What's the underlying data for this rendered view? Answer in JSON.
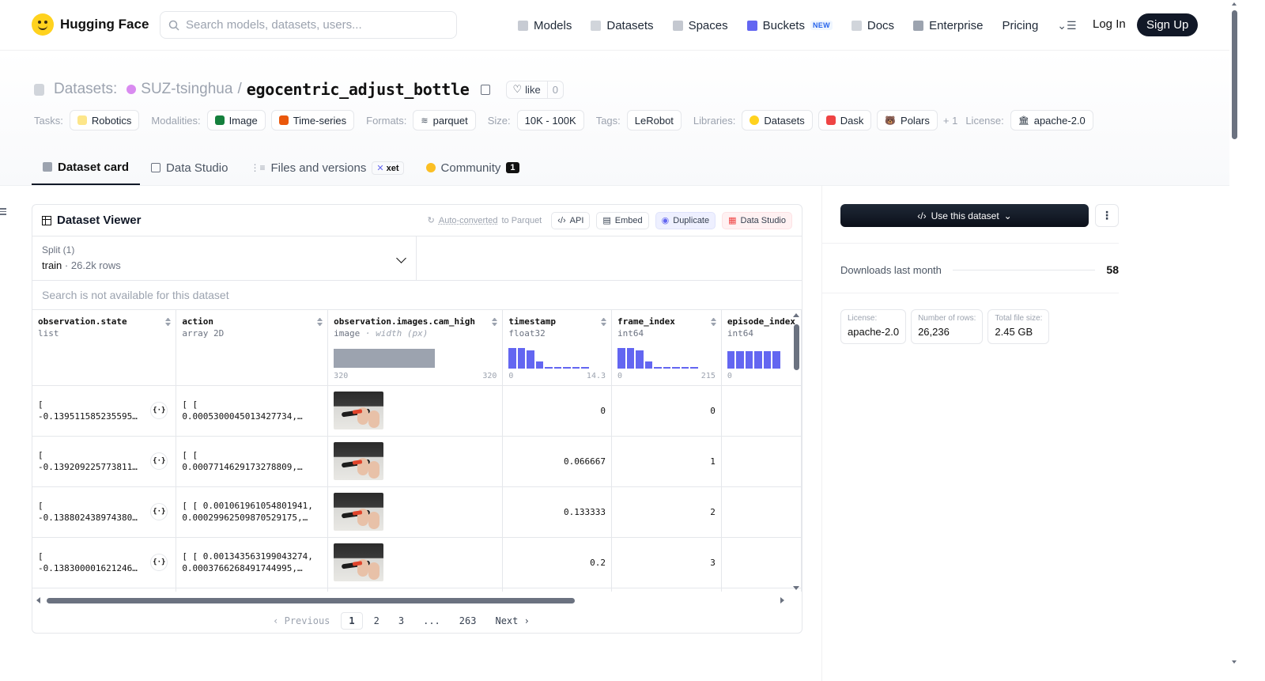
{
  "nav": {
    "brand": "Hugging Face",
    "search_placeholder": "Search models, datasets, users...",
    "links": [
      "Models",
      "Datasets",
      "Spaces",
      "Buckets",
      "Docs",
      "Enterprise",
      "Pricing"
    ],
    "buckets_badge": "NEW",
    "login": "Log In",
    "signup": "Sign Up"
  },
  "repo": {
    "prefix": "Datasets:",
    "org": "SUZ-tsinghua",
    "slash": "/",
    "name": "egocentric_adjust_bottle",
    "like_label": "like",
    "like_count": "0"
  },
  "tags": {
    "tasks_label": "Tasks:",
    "task": "Robotics",
    "modalities_label": "Modalities:",
    "modality_1": "Image",
    "modality_2": "Time-series",
    "formats_label": "Formats:",
    "format": "parquet",
    "size_label": "Size:",
    "size": "10K - 100K",
    "tags_label": "Tags:",
    "tag": "LeRobot",
    "libraries_label": "Libraries:",
    "lib_1": "Datasets",
    "lib_2": "Dask",
    "lib_3": "Polars",
    "more": "+ 1",
    "license_label": "License:",
    "license": "apache-2.0"
  },
  "tabs": {
    "card": "Dataset card",
    "studio": "Data Studio",
    "files": "Files and versions",
    "xet": "xet",
    "community": "Community",
    "community_count": "1"
  },
  "viewer": {
    "title": "Dataset Viewer",
    "auto_link": "Auto-converted",
    "auto_rest": "to Parquet",
    "api": "API",
    "embed": "Embed",
    "duplicate": "Duplicate",
    "data_studio": "Data Studio",
    "split_label": "Split (1)",
    "split_value": "train",
    "split_sep": "·",
    "split_rows": "26.2k rows",
    "search_na": "Search is not available for this dataset",
    "columns": [
      {
        "name": "observation.state",
        "type": "list"
      },
      {
        "name": "action",
        "type": "array 2D"
      },
      {
        "name": "observation.images.cam_high",
        "type": "image",
        "type_extra": "· width (px)",
        "min": "320",
        "max": "320"
      },
      {
        "name": "timestamp",
        "type": "float32",
        "min": "0",
        "max": "14.3"
      },
      {
        "name": "frame_index",
        "type": "int64",
        "min": "0",
        "max": "215"
      },
      {
        "name": "episode_index",
        "type": "int64",
        "min": "0"
      }
    ],
    "rows": [
      {
        "state": "[\n-0.139511585235595…",
        "action": "[ [\n0.0005300045013427734,…",
        "timestamp": "0",
        "frame": "0"
      },
      {
        "state": "[\n-0.139209225773811…",
        "action": "[ [\n0.0007714629173278809,…",
        "timestamp": "0.066667",
        "frame": "1"
      },
      {
        "state": "[\n-0.138802438974380…",
        "action": "[ [ 0.001061961054801941,\n0.00029962509870529175,…",
        "timestamp": "0.133333",
        "frame": "2"
      },
      {
        "state": "[\n-0.138300001621246…",
        "action": "[ [ 0.001343563199043274,\n0.0003766268491744995,…",
        "timestamp": "0.2",
        "frame": "3"
      }
    ],
    "pager": {
      "prev": "Previous",
      "p1": "1",
      "p2": "2",
      "p3": "3",
      "dots": "...",
      "last": "263",
      "next": "Next"
    }
  },
  "sidebar": {
    "use_btn": "Use this dataset",
    "downloads_label": "Downloads last month",
    "downloads_value": "58",
    "license_k": "License:",
    "license_v": "apache-2.0",
    "rows_k": "Number of rows:",
    "rows_v": "26,236",
    "size_k": "Total file size:",
    "size_v": "2.45 GB"
  },
  "hist": {
    "timestamp": [
      0.95,
      0.95,
      0.85,
      0.35,
      0.08,
      0.08,
      0.08,
      0.08,
      0.08
    ],
    "frame_index": [
      0.95,
      0.95,
      0.85,
      0.35,
      0.08,
      0.08,
      0.08,
      0.08,
      0.08
    ],
    "episode_index": [
      0.8,
      0.8,
      0.8,
      0.8,
      0.8,
      0.8
    ]
  },
  "colors": {
    "accent": "#6366f1",
    "dark": "#111827"
  }
}
